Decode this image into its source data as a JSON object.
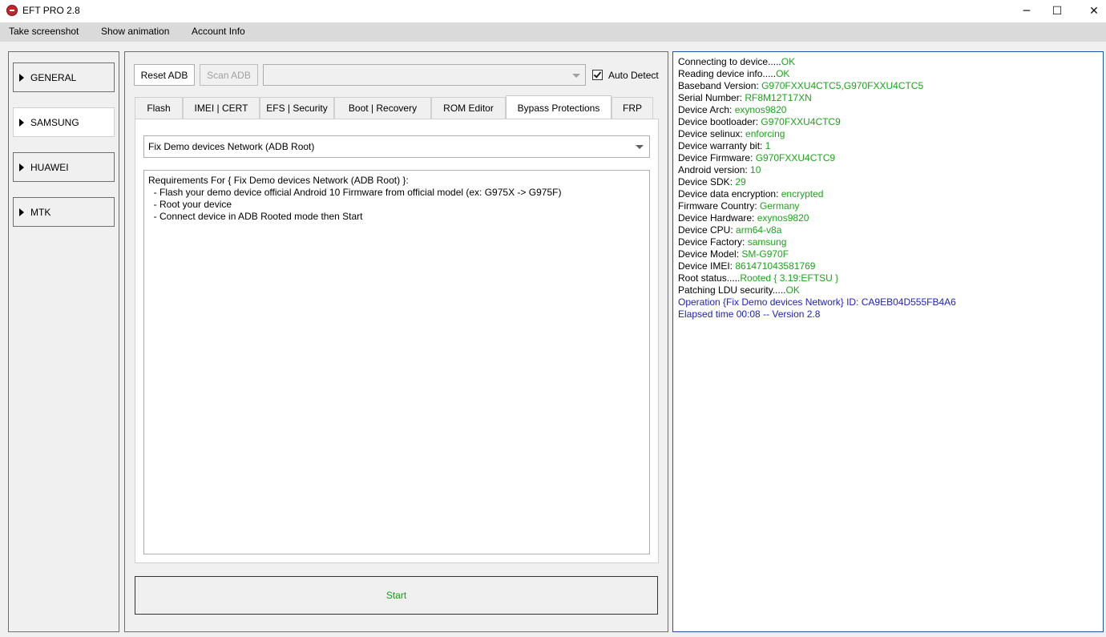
{
  "window": {
    "title": "EFT PRO 2.8",
    "controls": {
      "minimize": "─",
      "maximize": "☐",
      "close": "✕"
    }
  },
  "menu": [
    "Take screenshot",
    "Show animation",
    "Account Info"
  ],
  "sidebar": {
    "items": [
      {
        "label": "GENERAL",
        "active": false
      },
      {
        "label": "SAMSUNG",
        "active": true
      },
      {
        "label": "HUAWEI",
        "active": false
      },
      {
        "label": "MTK",
        "active": false
      }
    ]
  },
  "toolbar": {
    "reset_adb": "Reset ADB",
    "scan_adb": "Scan ADB",
    "port_value": "",
    "auto_detect_label": "Auto Detect",
    "auto_detect_checked": true
  },
  "tabs": [
    "Flash",
    "IMEI | CERT",
    "EFS | Security",
    "Boot | Recovery",
    "ROM Editor",
    "Bypass Protections",
    "FRP"
  ],
  "active_tab": "Bypass Protections",
  "operation": {
    "selected": "Fix Demo devices Network (ADB Root)",
    "requirements": [
      "Requirements For { Fix Demo devices Network (ADB Root) }:",
      "  - Flash your demo device official Android 10 Firmware from official model (ex: G975X -> G975F)",
      "  - Root your device",
      "  - Connect device in ADB Rooted mode then Start"
    ]
  },
  "start_label": "Start",
  "colors": {
    "ok_green": "#1aa41a",
    "info_blue": "#1d1dc0",
    "log_border": "#1c55a8"
  },
  "log": [
    {
      "key": "Connecting to device.....",
      "value": "OK"
    },
    {
      "key": "Reading device info.....",
      "value": "OK"
    },
    {
      "key": "Baseband Version: ",
      "value": "G970FXXU4CTC5,G970FXXU4CTC5"
    },
    {
      "key": "Serial Number: ",
      "value": "RF8M12T17XN"
    },
    {
      "key": "Device Arch: ",
      "value": "exynos9820"
    },
    {
      "key": "Device bootloader: ",
      "value": "G970FXXU4CTC9"
    },
    {
      "key": "Device selinux: ",
      "value": "enforcing"
    },
    {
      "key": "Device warranty bit: ",
      "value": "1"
    },
    {
      "key": "Device Firmware: ",
      "value": "G970FXXU4CTC9"
    },
    {
      "key": "Android version: ",
      "value": "10"
    },
    {
      "key": "Device SDK: ",
      "value": "29"
    },
    {
      "key": "Device data encryption: ",
      "value": "encrypted"
    },
    {
      "key": "Firmware Country: ",
      "value": "Germany"
    },
    {
      "key": "Device Hardware: ",
      "value": "exynos9820"
    },
    {
      "key": "Device CPU: ",
      "value": "arm64-v8a"
    },
    {
      "key": "Device Factory: ",
      "value": "samsung"
    },
    {
      "key": "Device Model: ",
      "value": "SM-G970F"
    },
    {
      "key": "Device IMEI: ",
      "value": "861471043581769"
    },
    {
      "key": "Root status.....",
      "value": "Rooted { 3.19:EFTSU }"
    },
    {
      "key": "Patching LDU security.....",
      "value": "OK"
    },
    {
      "info": "Operation {Fix Demo devices Network} ID: CA9EB04D555FB4A6"
    },
    {
      "info": "Elapsed time 00:08 -- Version 2.8"
    }
  ]
}
